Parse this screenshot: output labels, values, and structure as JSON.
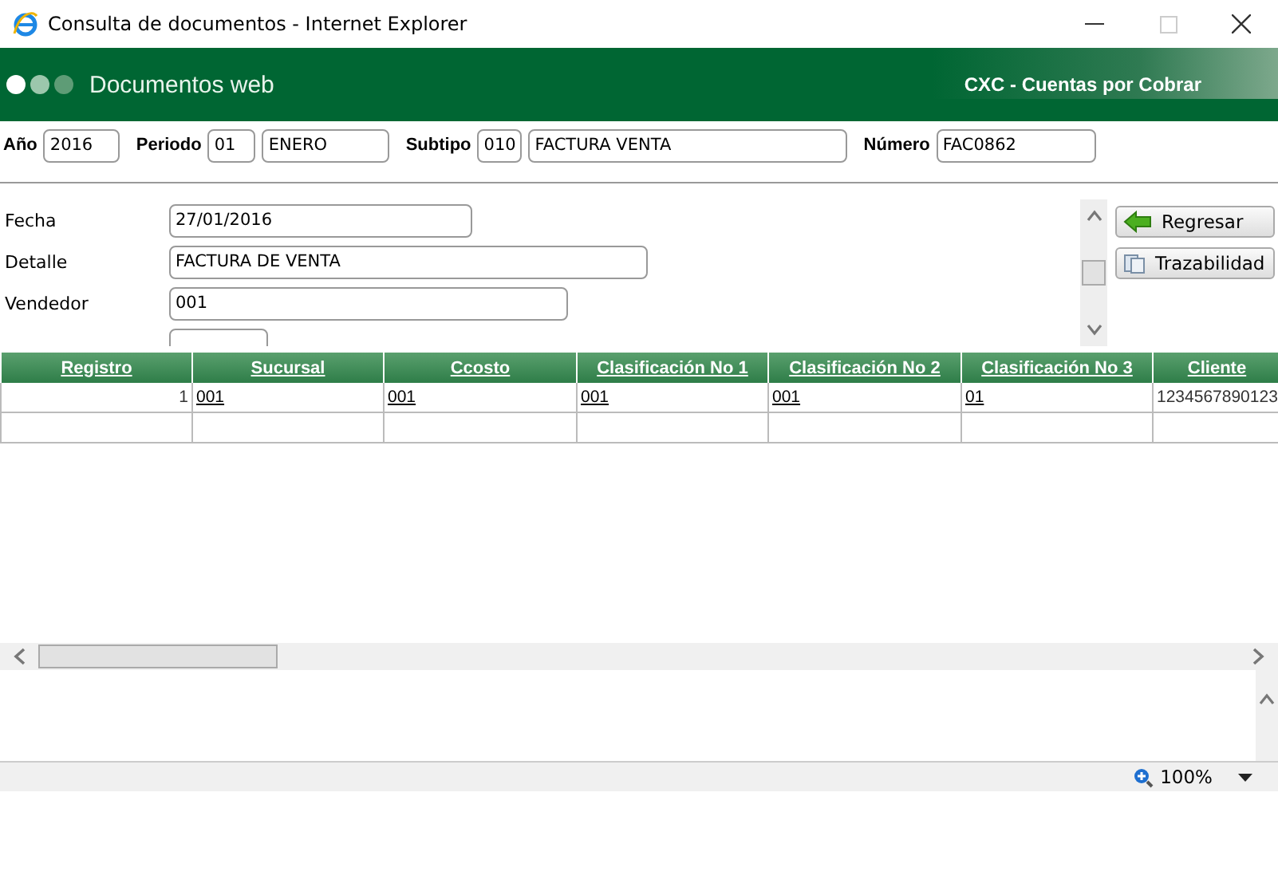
{
  "window": {
    "title": "Consulta de documentos - Internet Explorer"
  },
  "header": {
    "title": "Documentos web",
    "module": "CXC - Cuentas por Cobrar"
  },
  "filters": [
    {
      "label": "Año",
      "fields": [
        "2016"
      ]
    },
    {
      "label": "Periodo",
      "fields": [
        "01",
        "ENERO"
      ]
    },
    {
      "label": "Subtipo",
      "fields": [
        "010",
        "FACTURA VENTA"
      ]
    },
    {
      "label": "Número",
      "fields": [
        "FAC0862"
      ]
    }
  ],
  "form": [
    {
      "label": "Fecha",
      "value": "27/01/2016"
    },
    {
      "label": "Detalle",
      "value": "FACTURA DE VENTA"
    },
    {
      "label": "Vendedor",
      "value": "001"
    }
  ],
  "buttons": [
    {
      "label": "Regresar",
      "kind": "back"
    },
    {
      "label": "Trazabilidad",
      "kind": "trace"
    }
  ],
  "table": {
    "columns": [
      "Registro",
      "Sucursal",
      "Ccosto",
      "Clasificación No 1",
      "Clasificación No 2",
      "Clasificación No 3",
      "Cliente"
    ],
    "rows": [
      [
        {
          "text": "1",
          "link": false
        },
        {
          "text": "001",
          "link": true
        },
        {
          "text": "001",
          "link": true
        },
        {
          "text": "001",
          "link": true
        },
        {
          "text": "001",
          "link": true
        },
        {
          "text": "01",
          "link": true
        },
        {
          "text": "1234567890123",
          "link": false
        }
      ]
    ]
  },
  "status_bar": {
    "zoom": "100%"
  }
}
